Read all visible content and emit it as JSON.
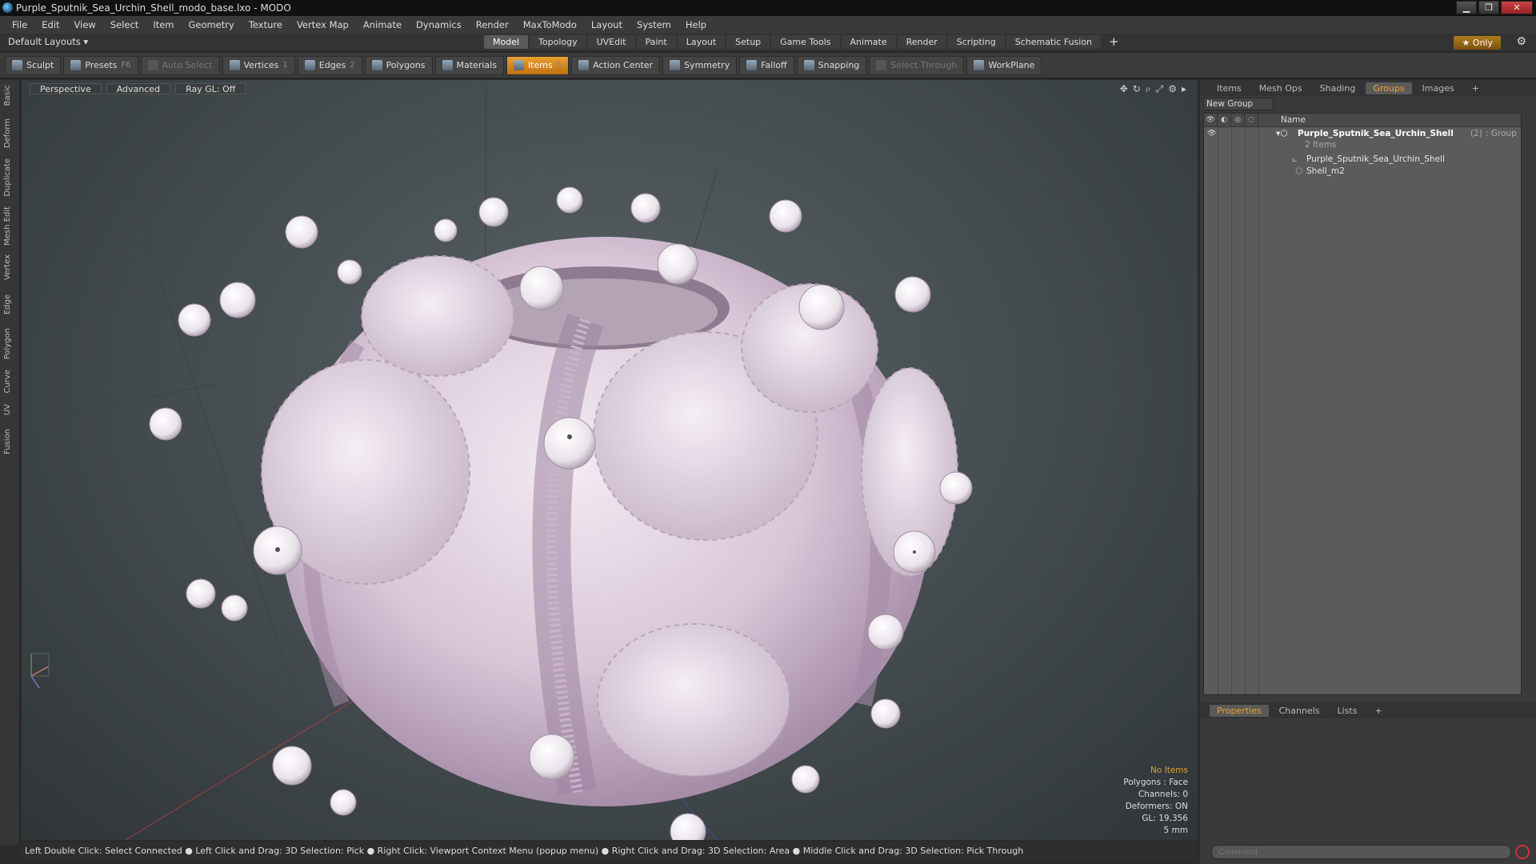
{
  "window": {
    "title": "Purple_Sputnik_Sea_Urchin_Shell_modo_base.lxo - MODO",
    "buttons": [
      "▁",
      "❐",
      "✕"
    ]
  },
  "menu": [
    "File",
    "Edit",
    "View",
    "Select",
    "Item",
    "Geometry",
    "Texture",
    "Vertex Map",
    "Animate",
    "Dynamics",
    "Render",
    "MaxToModo",
    "Layout",
    "System",
    "Help"
  ],
  "modebar": {
    "layout_selector": "Default Layouts ▾",
    "tabs": [
      "Model",
      "Topology",
      "UVEdit",
      "Paint",
      "Layout",
      "Setup",
      "Game Tools",
      "Animate",
      "Render",
      "Scripting",
      "Schematic Fusion",
      "+"
    ],
    "active_tab": "Model",
    "only_button": "★  Only",
    "gear": "⚙"
  },
  "toolbar": {
    "sculpt": "Sculpt",
    "presets": "Presets",
    "presets_key": "F6",
    "auto_select": "Auto Select",
    "vertices": "Vertices",
    "vertices_count": "1",
    "edges": "Edges",
    "edges_count": "2",
    "polygons": "Polygons",
    "materials": "Materials",
    "items": "Items",
    "items_count": "5",
    "action_center": "Action Center",
    "symmetry": "Symmetry",
    "falloff": "Falloff",
    "snapping": "Snapping",
    "select_through": "Select Through",
    "workplane": "WorkPlane"
  },
  "left_tabs": [
    "Basic",
    "Deform",
    "Duplicate",
    "Mesh Edit",
    "Vertex",
    "Edge",
    "Polygon",
    "Curve",
    "UV",
    "Fusion"
  ],
  "viewport": {
    "perspective": "Perspective",
    "advanced": "Advanced",
    "raygl": "Ray GL: Off",
    "stats": {
      "no_items": "No Items",
      "polygons": "Polygons : Face",
      "channels": "Channels: 0",
      "deformers": "Deformers: ON",
      "gl": "GL: 19,356",
      "unit": "5 mm"
    },
    "colors": {
      "shell": "#e7dbe6",
      "spine": "#f4f0f4",
      "groove": "#b59ab8"
    }
  },
  "status_bar": "Left Double Click: Select Connected ● Left Click and Drag: 3D Selection: Pick ● Right Click: Viewport Context Menu (popup menu) ● Right Click and Drag: 3D Selection: Area ● Middle Click and Drag: 3D Selection: Pick Through",
  "right_panel": {
    "tabs": [
      "Items",
      "Mesh Ops",
      "Shading",
      "Groups",
      "Images",
      "+"
    ],
    "active_tab": "Groups",
    "new_group": "New Group",
    "column_name": "Name",
    "group": {
      "name": "Purple_Sputnik_Sea_Urchin_Shell",
      "count": "(2)",
      "type": ": Group",
      "items_label": "2 Items"
    },
    "children": [
      "Purple_Sputnik_Sea_Urchin_Shell",
      "Shell_m2"
    ],
    "bottom_tabs": [
      "Properties",
      "Channels",
      "Lists",
      "+"
    ],
    "bottom_active": "Properties",
    "command_placeholder": "Command"
  }
}
